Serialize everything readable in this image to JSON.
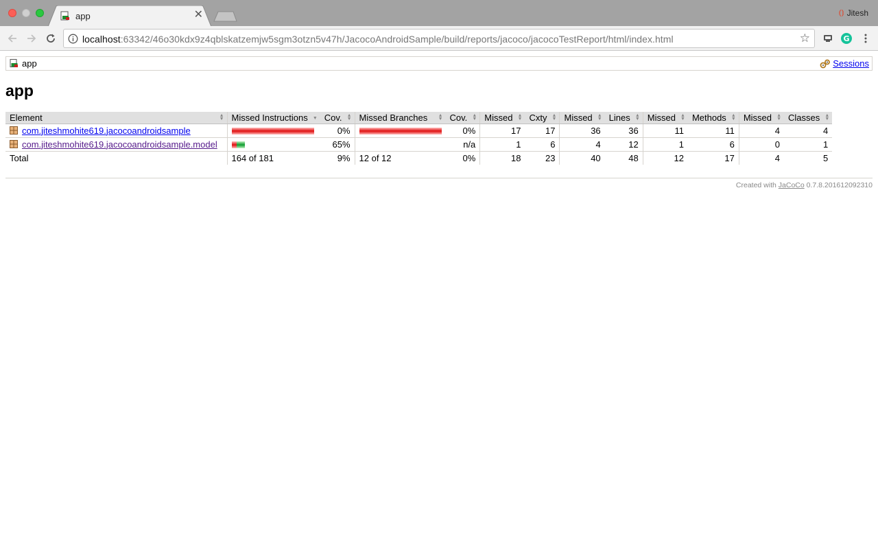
{
  "browser": {
    "tab_title": "app",
    "profile_name": "Jitesh",
    "url_host": "localhost",
    "url_rest": ":63342/46o30kdx9z4qblskatzemjw5sgm3otzn5v47h/JacocoAndroidSample/build/reports/jacoco/jacocoTestReport/html/index.html"
  },
  "page": {
    "breadcrumb": "app",
    "sessions_label": "Sessions",
    "title": "app"
  },
  "table": {
    "headers": [
      "Element",
      "Missed Instructions",
      "Cov.",
      "Missed Branches",
      "Cov.",
      "Missed",
      "Cxty",
      "Missed",
      "Lines",
      "Missed",
      "Methods",
      "Missed",
      "Classes"
    ],
    "rows": [
      {
        "element": "com.jiteshmohite619.jacocoandroidsample",
        "instr_cov": "0%",
        "branch_cov": "0%",
        "cxty_missed": "17",
        "cxty": "17",
        "lines_missed": "36",
        "lines": "36",
        "methods_missed": "11",
        "methods": "11",
        "classes_missed": "4",
        "classes": "4"
      },
      {
        "element": "com.jiteshmohite619.jacocoandroidsample.model",
        "instr_cov": "65%",
        "branch_cov": "n/a",
        "cxty_missed": "1",
        "cxty": "6",
        "lines_missed": "4",
        "lines": "12",
        "methods_missed": "1",
        "methods": "6",
        "classes_missed": "0",
        "classes": "1"
      }
    ],
    "total": {
      "label": "Total",
      "instructions": "164 of 181",
      "instr_cov": "9%",
      "branches": "12 of 12",
      "branch_cov": "0%",
      "cxty_missed": "18",
      "cxty": "23",
      "lines_missed": "40",
      "lines": "48",
      "methods_missed": "12",
      "methods": "17",
      "classes_missed": "4",
      "classes": "5"
    }
  },
  "footer": {
    "prefix": "Created with",
    "link": "JaCoCo",
    "version": "0.7.8.201612092310"
  },
  "colors": {
    "missed_bar": "#e21d1d",
    "covered_bar": "#1ca33a",
    "link": "#0000ee",
    "header_bg": "#e0e0e0"
  }
}
